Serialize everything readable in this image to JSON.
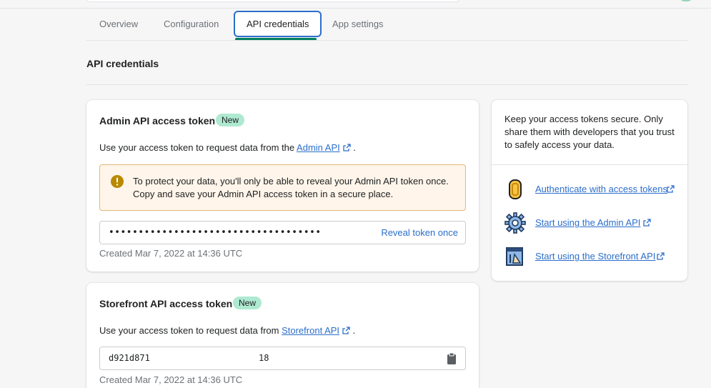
{
  "tabs": [
    {
      "label": "Overview"
    },
    {
      "label": "Configuration"
    },
    {
      "label": "API credentials"
    },
    {
      "label": "App settings"
    }
  ],
  "page_title": "API credentials",
  "admin_card": {
    "title": "Admin API access token",
    "badge": "New",
    "desc_prefix": "Use your access token to request data from the",
    "desc_link": "Admin API",
    "desc_suffix": ".",
    "banner_text": "To protect your data, you'll only be able to reveal your Admin API token once. Copy and save your Admin API access token in a secure place.",
    "token_masked": "••••••••••••••••••••••••••••••••••••",
    "reveal_label": "Reveal token once",
    "created": "Created Mar 7, 2022 at 14:36 UTC"
  },
  "storefront_card": {
    "title": "Storefront API access token",
    "badge": "New",
    "desc_prefix": "Use your access token to request data from",
    "desc_link": "Storefront API",
    "desc_suffix": ".",
    "token_visible": "d921d871",
    "token_tail": "18",
    "created": "Created Mar 7, 2022 at 14:36 UTC"
  },
  "side_card": {
    "text": "Keep your access tokens secure. Only share them with developers that you trust to safely access your data.",
    "links": [
      {
        "label": "Authenticate with access tokens",
        "icon": "coin-icon"
      },
      {
        "label": "Start using the Admin API",
        "icon": "gear-icon"
      },
      {
        "label": "Start using the Storefront API",
        "icon": "storefront-icon"
      }
    ]
  },
  "colors": {
    "accent": "#2c6ecb",
    "active_underline": "#008060",
    "badge_bg": "#aee9d1",
    "warning_bg": "#fff5ea",
    "warning_border": "#e1b878",
    "warning_icon": "#b98900"
  }
}
